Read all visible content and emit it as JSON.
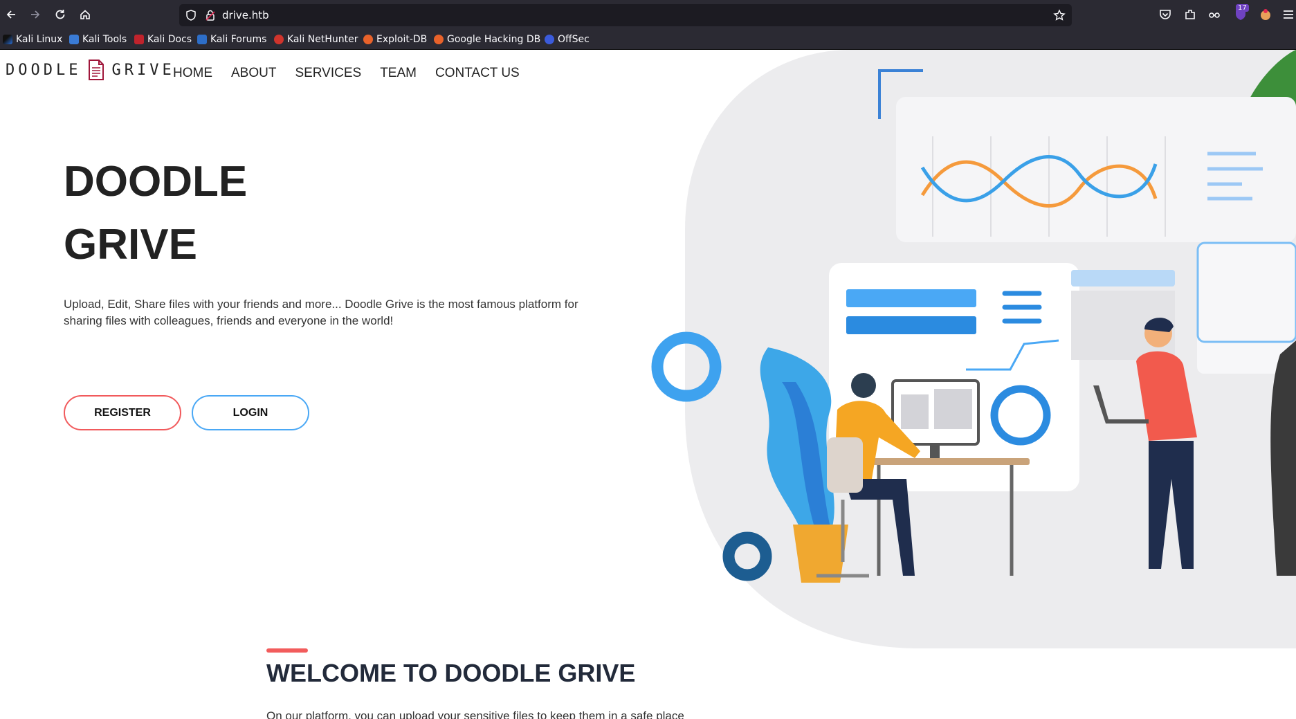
{
  "browser": {
    "url": "drive.htb",
    "extension_badge": "17",
    "bookmarks": [
      {
        "label": "Kali Linux",
        "icon": "kali-dragon-icon"
      },
      {
        "label": "Kali Tools",
        "icon": "kali-tools-icon"
      },
      {
        "label": "Kali Docs",
        "icon": "kali-docs-icon"
      },
      {
        "label": "Kali Forums",
        "icon": "kali-forums-icon"
      },
      {
        "label": "Kali NetHunter",
        "icon": "kali-nethunter-icon"
      },
      {
        "label": "Exploit-DB",
        "icon": "exploit-db-icon"
      },
      {
        "label": "Google Hacking DB",
        "icon": "ghdb-icon"
      },
      {
        "label": "OffSec",
        "icon": "offsec-icon"
      }
    ]
  },
  "site": {
    "logo_left": "DOODLE",
    "logo_right": "GRIVE",
    "nav": [
      "HOME",
      "ABOUT",
      "SERVICES",
      "TEAM",
      "CONTACT US"
    ]
  },
  "hero": {
    "title_line1": "DOODLE",
    "title_line2": "GRIVE",
    "description": "Upload, Edit, Share files with your friends and more... Doodle Grive is the most famous platform for sharing files with colleagues, friends and everyone in the world!",
    "register_label": "REGISTER",
    "login_label": "LOGIN"
  },
  "welcome": {
    "title": "WELCOME TO DOODLE GRIVE",
    "text": "On our platform, you can upload your sensitive files to keep them in a safe place"
  },
  "colors": {
    "accent_red": "#f15a5c",
    "accent_blue": "#4aa8f5",
    "chrome_bg": "#2b2a33"
  }
}
